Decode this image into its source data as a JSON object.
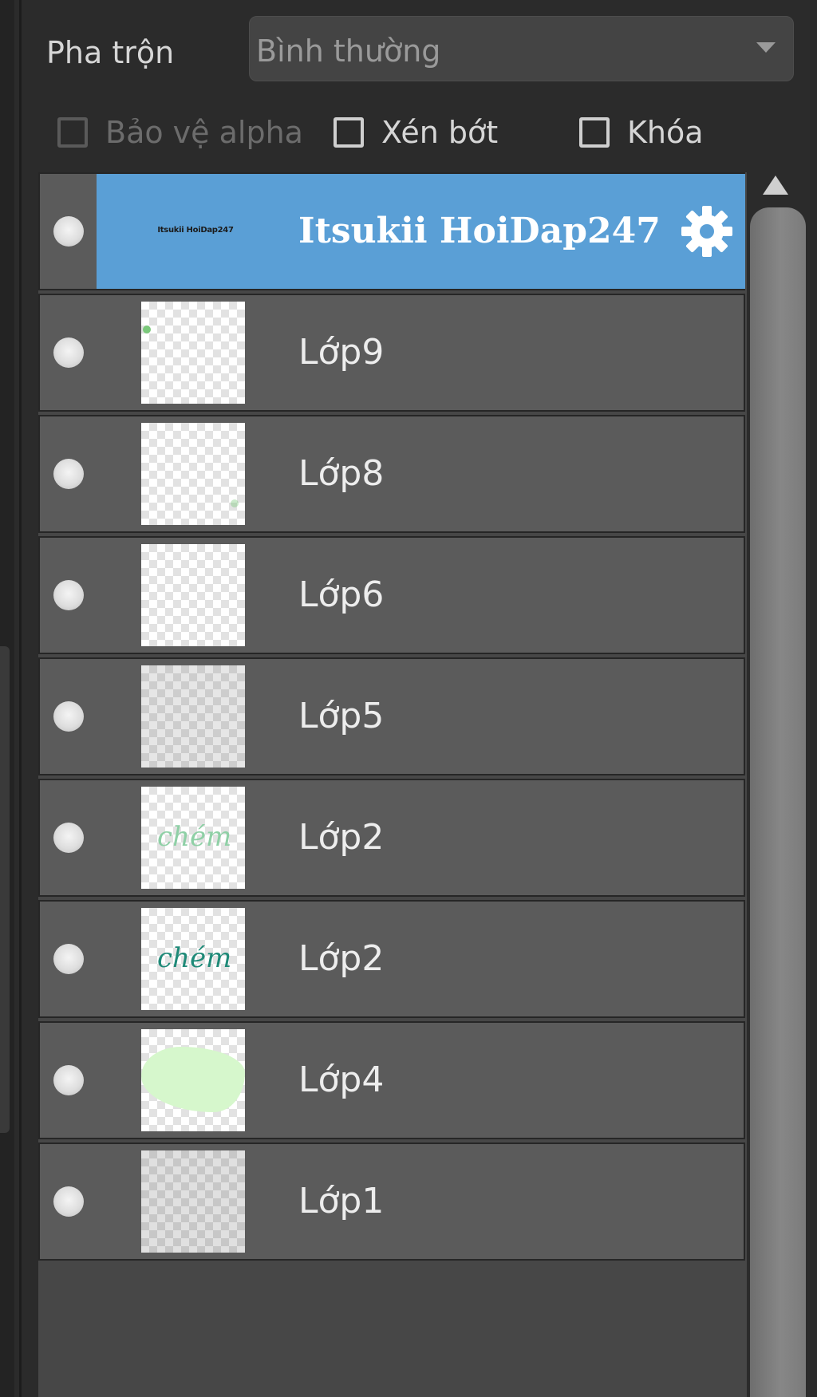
{
  "blend": {
    "label": "Pha trộn",
    "value": "Bình thường"
  },
  "options": {
    "protect_alpha": "Bảo vệ alpha",
    "clip": "Xén bớt",
    "lock": "Khóa"
  },
  "layers": [
    {
      "name": "Itsukii HoiDap247",
      "thumb_text": "Itsukii HoiDap247",
      "selected": true
    },
    {
      "name": "Lớp9"
    },
    {
      "name": "Lớp8"
    },
    {
      "name": "Lớp6"
    },
    {
      "name": "Lớp5"
    },
    {
      "name": "Lớp2",
      "thumb_text": "chém"
    },
    {
      "name": "Lớp2",
      "thumb_text": "chém"
    },
    {
      "name": "Lớp4"
    },
    {
      "name": "Lớp1"
    }
  ],
  "colors": {
    "selected": "#5a9fd6",
    "row": "#5b5b5b",
    "panel": "#2b2b2b"
  }
}
